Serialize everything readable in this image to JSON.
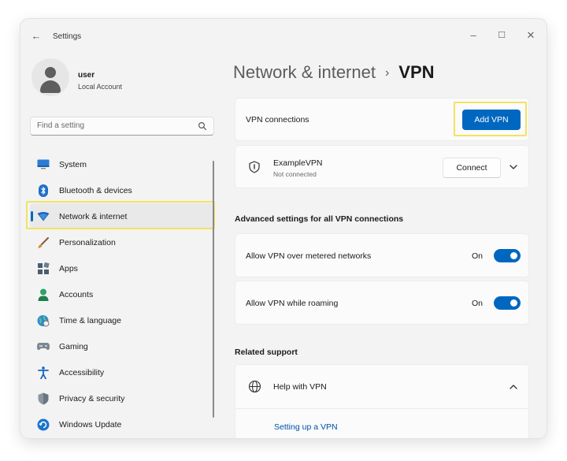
{
  "window": {
    "title": "Settings",
    "controls": {
      "minimize": "–",
      "maximize": "☐",
      "close": "✕"
    }
  },
  "user": {
    "name": "user",
    "account_type": "Local Account"
  },
  "search": {
    "placeholder": "Find a setting"
  },
  "sidebar": {
    "items": [
      {
        "label": "System",
        "icon": "system-icon",
        "active": false
      },
      {
        "label": "Bluetooth & devices",
        "icon": "bluetooth-icon",
        "active": false
      },
      {
        "label": "Network & internet",
        "icon": "network-icon",
        "active": true
      },
      {
        "label": "Personalization",
        "icon": "brush-icon",
        "active": false
      },
      {
        "label": "Apps",
        "icon": "apps-icon",
        "active": false
      },
      {
        "label": "Accounts",
        "icon": "accounts-icon",
        "active": false
      },
      {
        "label": "Time & language",
        "icon": "globe-clock-icon",
        "active": false
      },
      {
        "label": "Gaming",
        "icon": "gamepad-icon",
        "active": false
      },
      {
        "label": "Accessibility",
        "icon": "accessibility-icon",
        "active": false
      },
      {
        "label": "Privacy & security",
        "icon": "shield-icon",
        "active": false
      },
      {
        "label": "Windows Update",
        "icon": "update-icon",
        "active": false
      }
    ]
  },
  "header": {
    "parent": "Network & internet",
    "separator": "›",
    "current": "VPN"
  },
  "vpn_connections": {
    "label": "VPN connections",
    "add_button": "Add VPN"
  },
  "vpn_entry": {
    "name": "ExampleVPN",
    "status": "Not connected",
    "connect_button": "Connect"
  },
  "advanced": {
    "title": "Advanced settings for all VPN connections",
    "settings": [
      {
        "label": "Allow VPN over metered networks",
        "state": "On",
        "enabled": true
      },
      {
        "label": "Allow VPN while roaming",
        "state": "On",
        "enabled": true
      }
    ]
  },
  "related": {
    "title": "Related support",
    "help_label": "Help with VPN",
    "link": "Setting up a VPN"
  },
  "colors": {
    "accent": "#0067c0",
    "highlight": "#f3e260",
    "background": "#f3f3f3",
    "card": "#fbfbfb"
  }
}
